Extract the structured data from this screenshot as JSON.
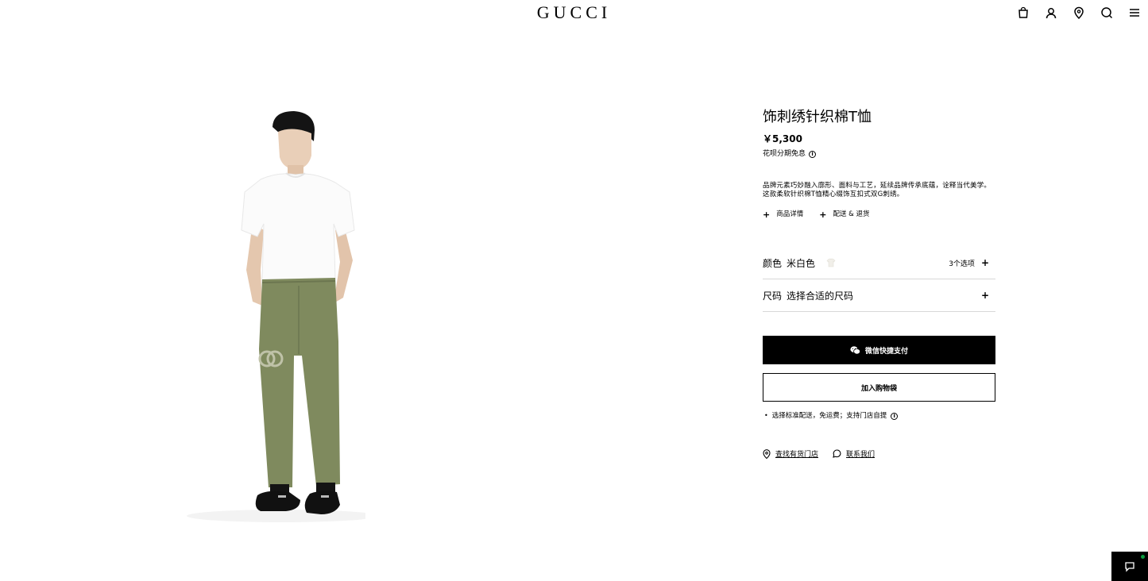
{
  "header": {
    "logo": "GUCCI",
    "icons": [
      "shopping-bag-icon",
      "account-icon",
      "store-locator-icon",
      "search-icon",
      "menu-icon"
    ]
  },
  "product": {
    "title": "饰刺绣针织棉T恤",
    "price": "￥5,300",
    "installment": "花呗分期免息",
    "description_line1": "品牌元素巧妙融入廓形、面料与工艺，延续品牌传承底蕴，诠释当代美学。",
    "description_line2": "这款柔软针织棉T恤精心缀饰互扣式双G刺绣。",
    "details_link": "商品详情",
    "shipping_link": "配送 & 退货"
  },
  "color_selector": {
    "label": "颜色",
    "value": "米白色",
    "options_count": "3个选项",
    "swatch_color": "#f1efe9"
  },
  "size_selector": {
    "label": "尺码",
    "value": "选择合适的尺码"
  },
  "actions": {
    "wechat_pay": "微信快捷支付",
    "add_to_bag": "加入购物袋"
  },
  "shipping_note": "选择标准配送，免运费；支持门店自提",
  "bottom_links": {
    "find_store": "查找有货门店",
    "contact_us": "联系我们"
  },
  "colors": {
    "brand_black": "#000000",
    "background": "#ffffff",
    "online_dot": "#0a9b3e"
  }
}
